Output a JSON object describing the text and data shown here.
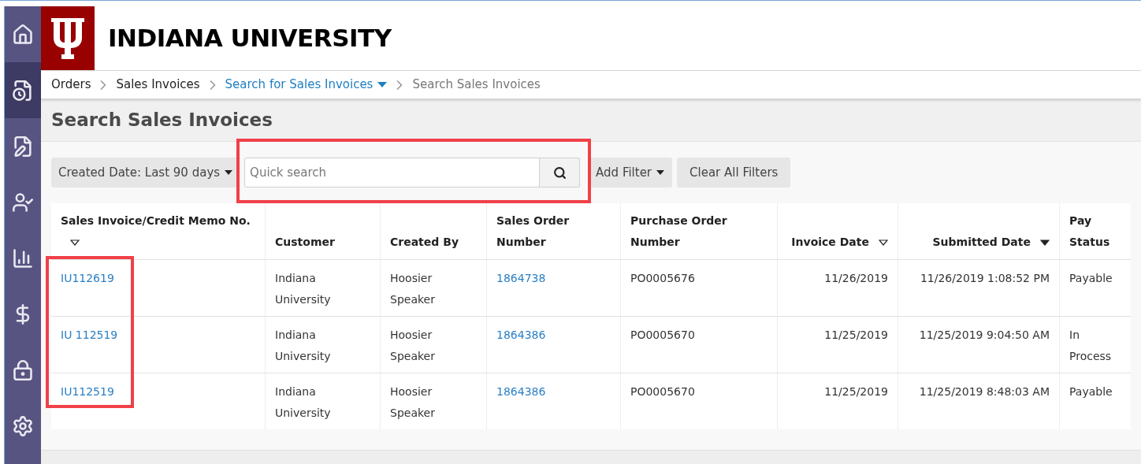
{
  "sidebar": {
    "items": [
      {
        "selected": false
      },
      {
        "selected": true
      },
      {
        "selected": false
      },
      {
        "selected": false
      },
      {
        "selected": false
      },
      {
        "selected": false
      },
      {
        "selected": false
      },
      {
        "selected": false
      }
    ]
  },
  "header": {
    "title": "INDIANA UNIVERSITY"
  },
  "breadcrumbs": [
    {
      "label": "Orders",
      "kind": "plain"
    },
    {
      "label": "Sales Invoices",
      "kind": "plain"
    },
    {
      "label": "Search for Sales Invoices",
      "kind": "menu"
    },
    {
      "label": "Search Sales Invoices",
      "kind": "current"
    }
  ],
  "page_title": "Search Sales Invoices",
  "filters": {
    "date_filter": "Created Date: Last 90 days",
    "search": {
      "placeholder": "Quick search"
    },
    "add_filter": "Add Filter",
    "clear": "Clear All Filters"
  },
  "table": {
    "columns": [
      {
        "label": "Sales Invoice/Credit Memo No.",
        "kind": "sortable"
      },
      {
        "label": "Customer",
        "kind": "plain"
      },
      {
        "label": "Created By",
        "kind": "plain"
      },
      {
        "label": "Sales Order Number",
        "kind": "plain"
      },
      {
        "label": "Purchase Order Number",
        "kind": "plain"
      },
      {
        "label": "Invoice Date",
        "kind": "sortable"
      },
      {
        "label": "Submitted Date",
        "kind": "sorted"
      },
      {
        "label": "Pay Status",
        "kind": "plain"
      }
    ],
    "rows": [
      [
        {
          "text": "IU112619",
          "kind": "link"
        },
        {
          "text": "Indiana University",
          "kind": "text"
        },
        {
          "text": "Hoosier Speaker",
          "kind": "text"
        },
        {
          "text": "1864738",
          "kind": "link"
        },
        {
          "text": "PO0005676",
          "kind": "text"
        },
        {
          "text": "11/26/2019",
          "kind": "text"
        },
        {
          "text": "11/26/2019 1:08:52 PM",
          "kind": "text"
        },
        {
          "text": "Payable",
          "kind": "text"
        }
      ],
      [
        {
          "text": "IU 112519",
          "kind": "link"
        },
        {
          "text": "Indiana University",
          "kind": "text"
        },
        {
          "text": "Hoosier Speaker",
          "kind": "text"
        },
        {
          "text": "1864386",
          "kind": "link"
        },
        {
          "text": "PO0005670",
          "kind": "text"
        },
        {
          "text": "11/25/2019",
          "kind": "text"
        },
        {
          "text": "11/25/2019 9:04:50 AM",
          "kind": "text"
        },
        {
          "text": "In Process",
          "kind": "text"
        }
      ],
      [
        {
          "text": "IU112519",
          "kind": "link"
        },
        {
          "text": "Indiana University",
          "kind": "text"
        },
        {
          "text": "Hoosier Speaker",
          "kind": "text"
        },
        {
          "text": "1864386",
          "kind": "link"
        },
        {
          "text": "PO0005670",
          "kind": "text"
        },
        {
          "text": "11/25/2019",
          "kind": "text"
        },
        {
          "text": "11/25/2019 8:48:03 AM",
          "kind": "text"
        },
        {
          "text": "Payable",
          "kind": "text"
        }
      ]
    ]
  }
}
